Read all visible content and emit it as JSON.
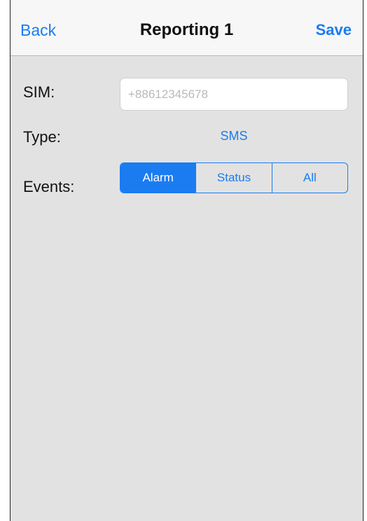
{
  "navbar": {
    "back_label": "Back",
    "title": "Reporting 1",
    "save_label": "Save"
  },
  "form": {
    "sim": {
      "label": "SIM:",
      "value": "",
      "placeholder": "+88612345678"
    },
    "type": {
      "label": "Type:",
      "value": "SMS"
    },
    "events": {
      "label": "Events:",
      "options": [
        "Alarm",
        "Status",
        "All"
      ],
      "selected": "Alarm"
    }
  },
  "colors": {
    "accent": "#1a7cf0",
    "background": "#e2e2e2",
    "navbar": "#f7f7f7"
  }
}
